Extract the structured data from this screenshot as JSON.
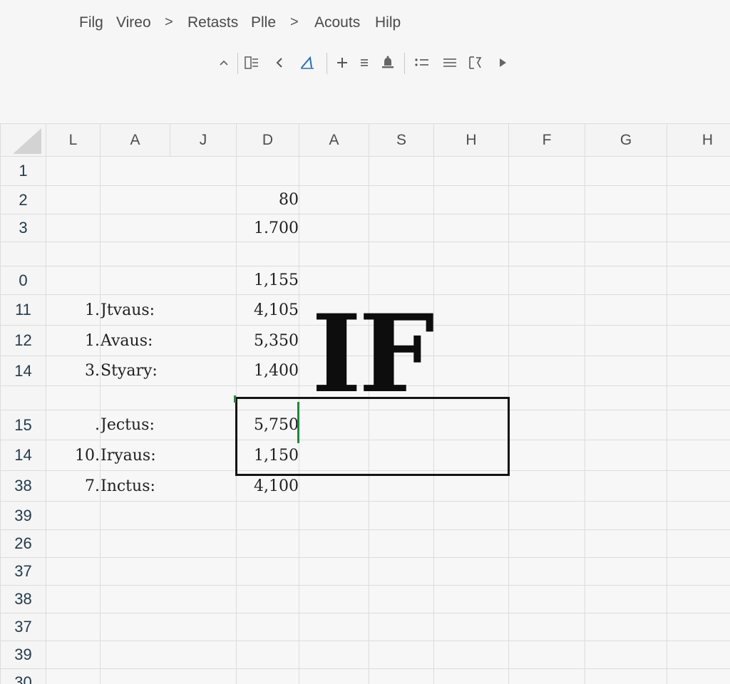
{
  "menu": {
    "items": [
      "Filg",
      "Vireo",
      "Retasts",
      "Plle",
      "Acouts",
      "Hilp"
    ],
    "separator": ">"
  },
  "toolbar": {
    "icons": [
      "caret-up-icon",
      "list-grid-icon",
      "chevron-left-icon",
      "pen-icon",
      "plus-icon",
      "equals-icon",
      "bell-icon",
      "bullet-list-icon",
      "lines-icon",
      "format-icon",
      "play-right-icon"
    ]
  },
  "grid": {
    "columns": [
      "L",
      "A",
      "J",
      "D",
      "A",
      "S",
      "H",
      "F",
      "G",
      "H"
    ],
    "rows": [
      {
        "num": "1",
        "idx": "",
        "label": "",
        "value": ""
      },
      {
        "num": "2",
        "idx": "",
        "label": "",
        "value": "80"
      },
      {
        "num": "3",
        "idx": "",
        "label": "",
        "value": "1.700"
      },
      {
        "num": "",
        "idx": "",
        "label": "",
        "value": ""
      },
      {
        "num": "0",
        "idx": "",
        "label": "",
        "value": "1,155"
      },
      {
        "num": "11",
        "idx": "1.",
        "label": "Jtvaus:",
        "value": "4,105"
      },
      {
        "num": "12",
        "idx": "1.",
        "label": "Avaus:",
        "value": "5,350"
      },
      {
        "num": "14",
        "idx": "3.",
        "label": "Styary:",
        "value": "1,400"
      },
      {
        "num": "",
        "idx": "",
        "label": "",
        "value": ""
      },
      {
        "num": "15",
        "idx": ".",
        "label": "Jectus:",
        "value": "5,750"
      },
      {
        "num": "14",
        "idx": "10.",
        "label": "Iryaus:",
        "value": "1,150"
      },
      {
        "num": "38",
        "idx": "7.",
        "label": "Inctus:",
        "value": "4,100"
      },
      {
        "num": "39",
        "idx": "",
        "label": "",
        "value": ""
      },
      {
        "num": "26",
        "idx": "",
        "label": "",
        "value": ""
      },
      {
        "num": "37",
        "idx": "",
        "label": "",
        "value": ""
      },
      {
        "num": "38",
        "idx": "",
        "label": "",
        "value": ""
      },
      {
        "num": "37",
        "idx": "",
        "label": "",
        "value": ""
      },
      {
        "num": "39",
        "idx": "",
        "label": "",
        "value": ""
      },
      {
        "num": "30",
        "idx": "",
        "label": "",
        "value": ""
      }
    ]
  },
  "overlay": {
    "text": "IF"
  },
  "colors": {
    "background": "#f6f6f6",
    "gridline": "#dcdcdc",
    "cursor": "#1f8a3a",
    "selection_border": "#141414"
  }
}
